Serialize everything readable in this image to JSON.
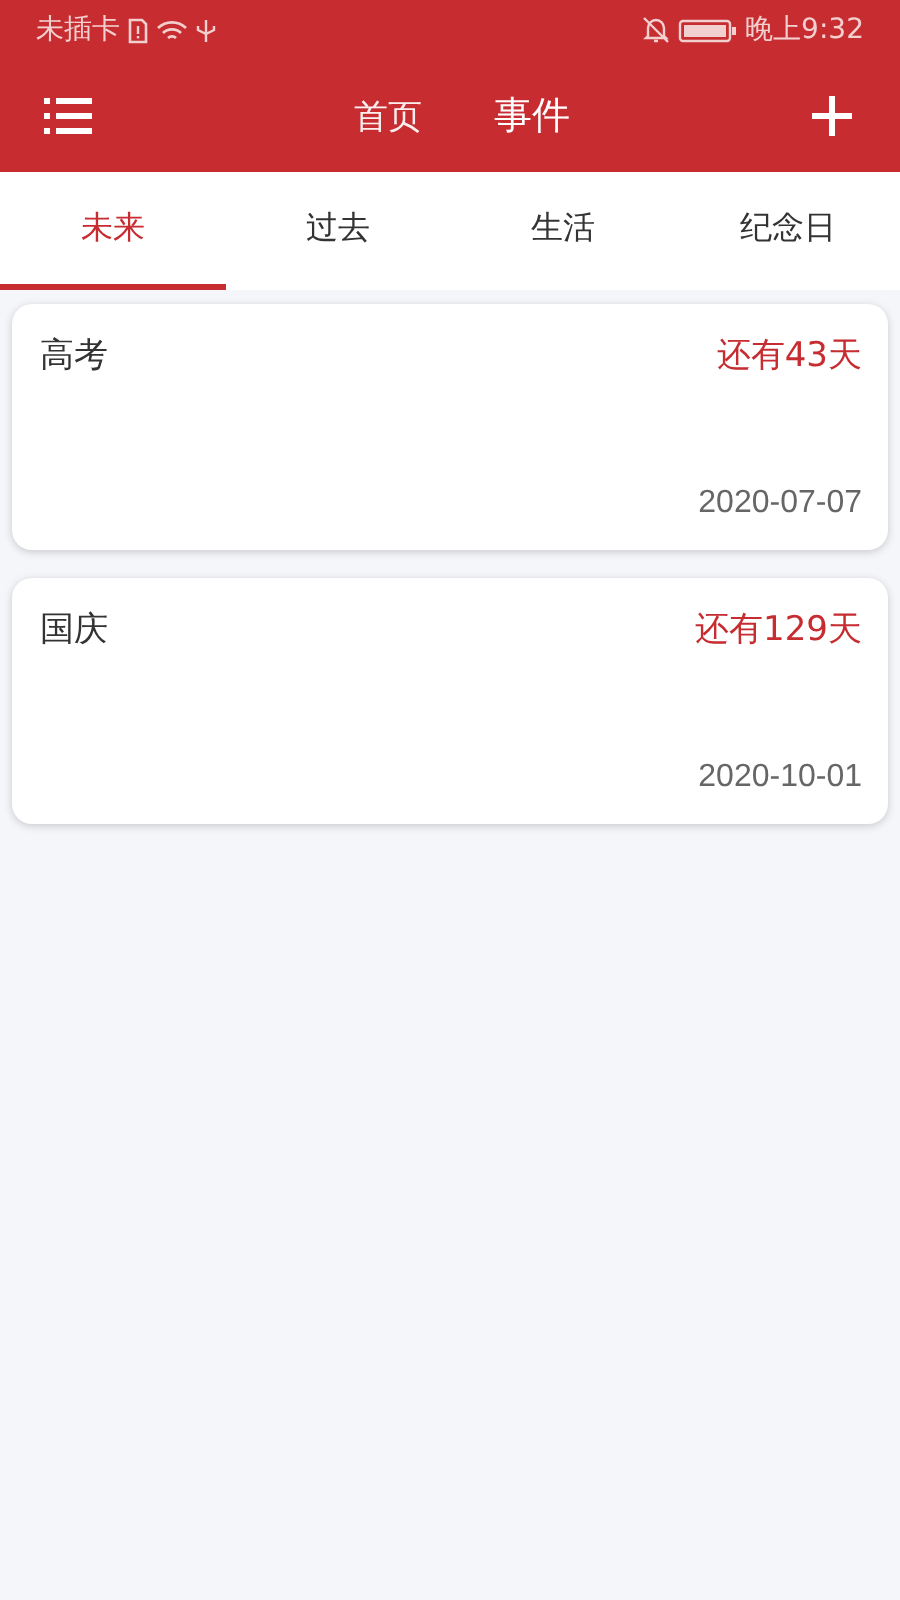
{
  "status_bar": {
    "carrier": "未插卡",
    "time": "晚上9:32"
  },
  "toolbar": {
    "tabs": [
      {
        "label": "首页",
        "selected": false
      },
      {
        "label": "事件",
        "selected": true
      }
    ]
  },
  "category_tabs": [
    {
      "label": "未来",
      "selected": true
    },
    {
      "label": "过去",
      "selected": false
    },
    {
      "label": "生活",
      "selected": false
    },
    {
      "label": "纪念日",
      "selected": false
    }
  ],
  "events": [
    {
      "title": "高考",
      "countdown": "还有43天",
      "date": "2020-07-07"
    },
    {
      "title": "国庆",
      "countdown": "还有129天",
      "date": "2020-10-01"
    }
  ]
}
